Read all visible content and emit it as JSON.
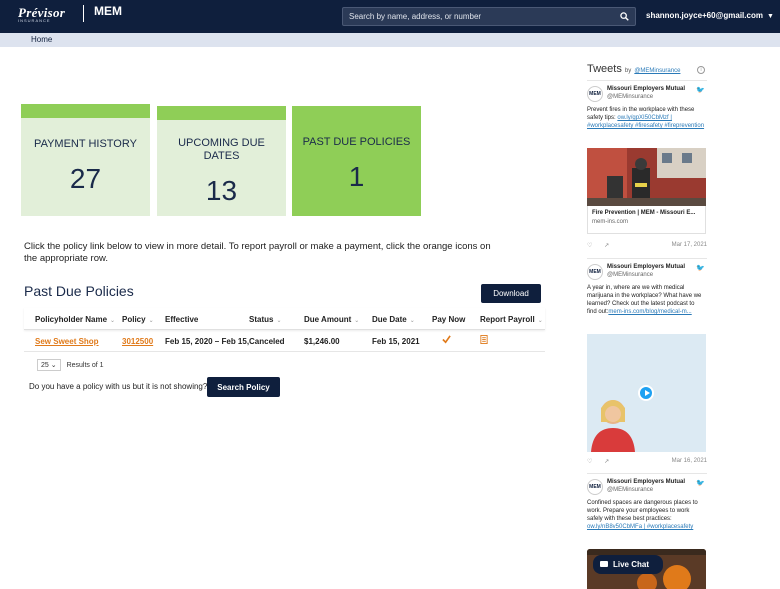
{
  "header": {
    "brand_primary": "Prévisor",
    "brand_primary_sub": "INSURANCE",
    "brand_secondary": "MEM",
    "search_placeholder": "Search by name, address, or number",
    "user_email": "shannon.joyce+60@gmail.com"
  },
  "nav": {
    "home_label": "Home"
  },
  "stats": [
    {
      "label": "PAYMENT HISTORY",
      "value": "27"
    },
    {
      "label": "UPCOMING DUE DATES",
      "value": "13"
    },
    {
      "label": "PAST DUE POLICIES",
      "value": "1"
    }
  ],
  "instructions": "Click the policy link below to view in more detail. To report payroll or make a payment, click the orange icons on the appropriate row.",
  "section": {
    "title": "Past Due Policies",
    "download_label": "Download"
  },
  "table": {
    "columns": [
      "Policyholder Name",
      "Policy",
      "Effective",
      "Status",
      "Due Amount",
      "Due Date",
      "Pay Now",
      "Report Payroll"
    ],
    "rows": [
      {
        "policyholder": "Sew Sweet Shop",
        "policy": "3012500",
        "effective": "Feb 15, 2020 – Feb 15,",
        "status": "Canceled",
        "due_amount": "$1,246.00",
        "due_date": "Feb 15, 2021"
      }
    ]
  },
  "pager": {
    "page_size": "25",
    "results": "Results of 1"
  },
  "policy_search": {
    "question": "Do you have a policy with us but it is not showing?",
    "button_label": "Search Policy"
  },
  "tweets": {
    "header": "Tweets",
    "by": "by",
    "handle": "@MEMinsurance",
    "items": [
      {
        "name": "Missouri Employers Mutual",
        "handle": "@MEMinsurance",
        "text": "Prevent fires in the workplace with these safety tips: ",
        "link": "ow.ly/gpXI50CbMzf | #workplacesafety #firesafety #fireprevention",
        "card_title": "Fire Prevention | MEM - Missouri E...",
        "card_url": "mem-ins.com",
        "date": "Mar 17, 2021"
      },
      {
        "name": "Missouri Employers Mutual",
        "handle": "@MEMinsurance",
        "text": "A year in, where are we with medical marijuana in the workplace? What have we learned? Check out the latest podcast to find out:",
        "link": "mem-ins.com/blog/medical-m...",
        "date": "Mar 16, 2021"
      },
      {
        "name": "Missouri Employers Mutual",
        "handle": "@MEMinsurance",
        "text": "Confined spaces are dangerous places to work. Prepare your employees to work safely with these best practices:",
        "link": "ow.ly/nB8v50CbMFa | #workplacesafety"
      }
    ]
  },
  "live_chat": {
    "label": "Live Chat"
  },
  "colors": {
    "navy": "#0f1f3d",
    "green_accent": "#8fce57",
    "green_light": "#e2efd9",
    "orange": "#e07a1a",
    "link_blue": "#2a7ab8"
  }
}
